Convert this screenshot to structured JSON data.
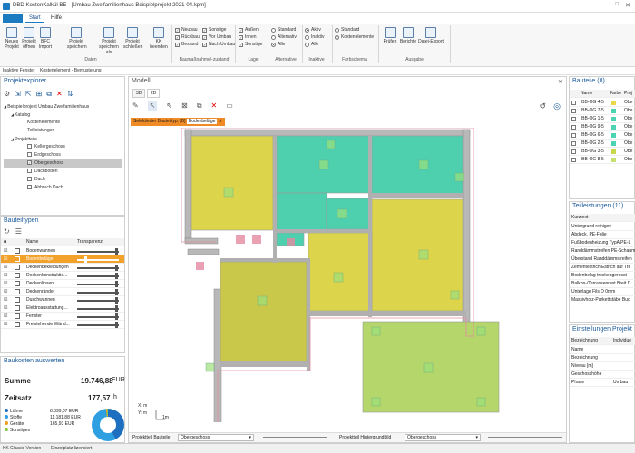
{
  "window": {
    "title": "DBD-KostenKalkül BE - [Umbau Zweifamilienhaus Beispielprojekt 2021-04.kpm]"
  },
  "menu": {
    "start": "Start",
    "hilfe": "Hilfe"
  },
  "ribbon": {
    "buttons": [
      {
        "label": "Neues Projekt",
        "icon": "new-project-icon"
      },
      {
        "label": "Projekt öffnen",
        "icon": "open-folder-icon"
      },
      {
        "label": "BFC Import",
        "icon": "import-icon"
      },
      {
        "label": "Projekt speichern",
        "icon": "save-icon"
      },
      {
        "label": "Projekt speichern als",
        "icon": "save-as-icon"
      },
      {
        "label": "Projekt schließen",
        "icon": "close-project-icon"
      },
      {
        "label": "KK beenden",
        "icon": "exit-icon"
      }
    ],
    "group_daten": "Daten",
    "massnahme": {
      "col1": [
        "Neubau",
        "Rückbau",
        "Bestand"
      ],
      "col2": [
        "Sonstige",
        "Vor Umbau",
        "Nach Umbau"
      ],
      "group": "Baumaßnahme/-zustand"
    },
    "lage": {
      "items": [
        "Außen",
        "Innen",
        "Sonstige"
      ],
      "group": "Lage"
    },
    "alternative": {
      "items": [
        "Standard",
        "Alternativ",
        "Alle"
      ],
      "group": "Alternative"
    },
    "inaktive": {
      "items": [
        "Aktiv",
        "Inaktiv",
        "Alle"
      ],
      "group": "Inaktive"
    },
    "farbschema": {
      "items": [
        "Standard",
        "Kostenelemente"
      ],
      "group": "Farbschema"
    },
    "ausgabe": {
      "items": [
        "Prüfen",
        "Berichte",
        "Datei-Export"
      ],
      "group": "Ausgabe"
    }
  },
  "breadcrumb": {
    "a": "Inaktive Fenster",
    "b": "Kostenelement - Bemusterung"
  },
  "explorer": {
    "title": "Projektexplorer",
    "project": "Beispielprojekt Umbau Zweifamilienhaus",
    "katalog": "Katalog",
    "katalog_items": [
      "Kostenelemente",
      "Teilleistungen"
    ],
    "projektteile": "Projektteile",
    "parts": [
      "Kellergeschoss",
      "Erdgeschoss",
      "Obergeschoss",
      "Dachboden",
      "Dach",
      "Abbruch Dach"
    ]
  },
  "bauteiltypen": {
    "title": "Bauteiltypen",
    "col_name": "Name",
    "col_transparenz": "Transparenz",
    "items": [
      "Bodenwannen",
      "Bodenbeläge",
      "Deckenbekleidungen",
      "Deckenkonstruktio...",
      "Deckenlinsen",
      "Deckenränder",
      "Duschwannen",
      "Elektroausstattung...",
      "Fenster",
      "Freistehende Wänd..."
    ]
  },
  "kosten": {
    "title": "Baukosten auswerten",
    "summe_label": "Summe",
    "summe": "19.746,88",
    "currency": "EUR",
    "zeitsatz_label": "Zeitsatz",
    "zeitsatz": "177,57",
    "unit": "h",
    "legend": [
      {
        "label": "Löhne",
        "value": "8.399,07 EUR",
        "color": "#1e6fc0"
      },
      {
        "label": "Stoffe",
        "value": "11.181,88 EUR",
        "color": "#2e9fe0"
      },
      {
        "label": "Geräte",
        "value": "165,93 EUR",
        "color": "#f0a020"
      },
      {
        "label": "Sonstiges",
        "value": "",
        "color": "#8cc63f"
      }
    ]
  },
  "modell": {
    "title": "Modell",
    "tab3d": "3D",
    "tab2d": "2D",
    "selected_label": "Selektierter Bauteiltyp: [B]",
    "selected_value": "Bodenbeläge",
    "scale": "1m",
    "axis_x": "X: m",
    "axis_y": "Y: m"
  },
  "footer": {
    "projektteil_label": "Projektteil Bauteile",
    "projektteil_value": "Obergeschoss",
    "hintergrund_label": "Projektteil Hintergrundbild",
    "hintergrund_value": "Obergeschoss"
  },
  "bauteile": {
    "title": "Bauteile (8)",
    "col_name": "Name",
    "col_farbe": "Farbe",
    "col_proj": "Proj",
    "rows": [
      {
        "name": "iBB-OG 4-5",
        "color": "#e8d84a",
        "proj": "Obe"
      },
      {
        "name": "iBB-OG 7-5",
        "color": "#4bd3b2",
        "proj": "Obe"
      },
      {
        "name": "iBB-OG 1-5",
        "color": "#4bd3b2",
        "proj": "Obe"
      },
      {
        "name": "iBB-OG 9-5",
        "color": "#4bd3b2",
        "proj": "Obe"
      },
      {
        "name": "iBB-OG 6-5",
        "color": "#4bd3b2",
        "proj": "Obe"
      },
      {
        "name": "iBB-OG 2-5",
        "color": "#4bd3b2",
        "proj": "Obe"
      },
      {
        "name": "iBB-OG 3-5",
        "color": "#c8d84a",
        "proj": "Obe"
      },
      {
        "name": "iBB-OG 8-5",
        "color": "#c8e070",
        "proj": "Obe"
      }
    ]
  },
  "teilleistungen": {
    "title": "Teilleistungen (11)",
    "header": "Kurztext",
    "rows": [
      "Untergrund reinigen",
      "Abdeck. PE-Folie",
      "Fußbodenheizung TypA PE-L",
      "Randdämmstreifen PE-Schaum",
      "Überstand Randdämmstreifen",
      "Zementestrich Estrich auf Tre",
      "Bodenbelag trockengeresst",
      "Balkon-/Terrassenrost Breit D",
      "Unterlage Fils D 0mm",
      "Massivholz-Parkettstäbe Buc"
    ]
  },
  "einstellungen": {
    "title": "Einstellungen Projekt",
    "col_a": "Bezeichnung",
    "col_b": "Individue",
    "rows": [
      [
        "Name",
        ""
      ],
      [
        "Bezeichnung",
        ""
      ],
      [
        "Niveau [m]",
        ""
      ],
      [
        "Geschosshöhe",
        ""
      ],
      [
        "Phase",
        "Umbau"
      ]
    ]
  },
  "status": {
    "text": "KK Classic Version",
    "license": "Einzelplatz lizensiert"
  },
  "colors": {
    "yellow": "#dcd44a",
    "teal": "#4ed0ae",
    "green": "#b4d66a",
    "wall": "#9a9a9a",
    "accent": "#1a7bc1"
  }
}
